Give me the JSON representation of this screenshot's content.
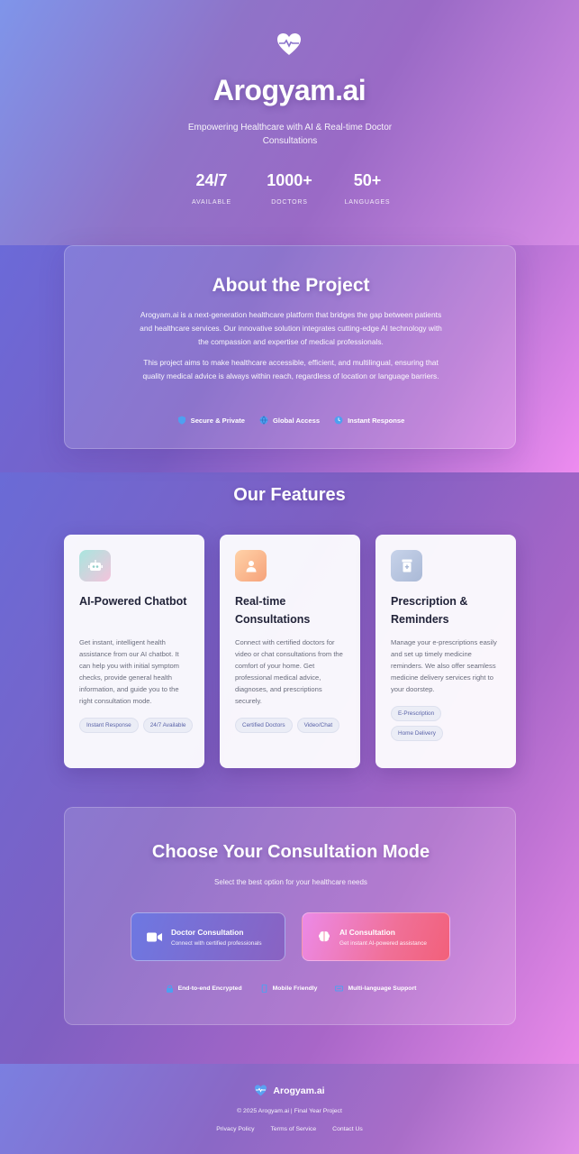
{
  "hero": {
    "brand": "Arogyam.ai",
    "tagline": "Empowering Healthcare with AI & Real-time Doctor Consultations",
    "stats": [
      {
        "value": "24/7",
        "label": "AVAILABLE"
      },
      {
        "value": "1000+",
        "label": "DOCTORS"
      },
      {
        "value": "50+",
        "label": "LANGUAGES"
      }
    ]
  },
  "about": {
    "title": "About the Project",
    "p1": "Arogyam.ai is a next-generation healthcare platform that bridges the gap between patients and healthcare services. Our innovative solution integrates cutting-edge AI technology with the compassion and expertise of medical professionals.",
    "p2": "This project aims to make healthcare accessible, efficient, and multilingual, ensuring that quality medical advice is always within reach, regardless of location or language barriers.",
    "pills": [
      "Secure & Private",
      "Global Access",
      "Instant Response"
    ]
  },
  "features": {
    "title": "Our Features",
    "cards": [
      {
        "title": "AI-Powered Chatbot",
        "icon": "robot-icon",
        "desc": "Get instant, intelligent health assistance from our AI chatbot. It can help you with initial symptom checks, provide general health information, and guide you to the right consultation mode.",
        "tags": [
          "Instant Response",
          "24/7 Available"
        ]
      },
      {
        "title": "Real-time Consultations",
        "icon": "doctor-icon",
        "desc": "Connect with certified doctors for video or chat consultations from the comfort of your home. Get professional medical advice, diagnoses, and prescriptions securely.",
        "tags": [
          "Certified Doctors",
          "Video/Chat"
        ]
      },
      {
        "title": "Prescription & Reminders",
        "icon": "prescription-bottle-icon",
        "desc": "Manage your e-prescriptions easily and set up timely medicine reminders. We also offer seamless medicine delivery services right to your doorstep.",
        "tags": [
          "E-Prescription",
          "Home Delivery"
        ]
      }
    ]
  },
  "mode": {
    "title": "Choose Your Consultation Mode",
    "subtitle": "Select the best option for your healthcare needs",
    "doctor": {
      "title": "Doctor Consultation",
      "sub": "Connect with certified professionals"
    },
    "ai": {
      "title": "AI Consultation",
      "sub": "Get instant AI-powered assistance"
    },
    "features": [
      "End-to-end Encrypted",
      "Mobile Friendly",
      "Multi-language Support"
    ]
  },
  "footer": {
    "brand": "Arogyam.ai",
    "copyright": "© 2025 Arogyam.ai | Final Year Project",
    "links": [
      "Privacy Policy",
      "Terms of Service",
      "Contact Us"
    ]
  },
  "colors": {
    "accent": "#6d78e2",
    "pink": "#f07098",
    "tag_text": "#5a63a8"
  }
}
